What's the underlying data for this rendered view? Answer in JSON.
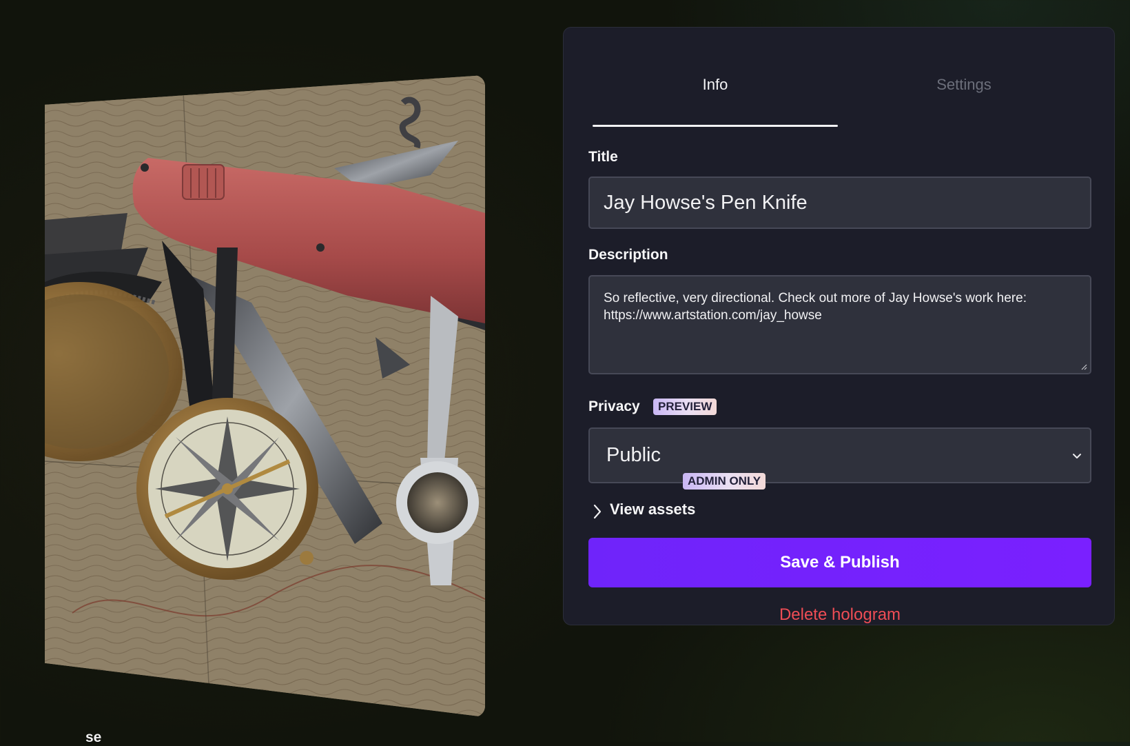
{
  "preview": {
    "caption": "se",
    "image_alt": "Red pen knife with compass on a topographic map"
  },
  "tabs": [
    {
      "label": "Info",
      "active": true
    },
    {
      "label": "Settings",
      "active": false
    }
  ],
  "form": {
    "title_label": "Title",
    "title_value": "Jay Howse's Pen Knife",
    "description_label": "Description",
    "description_value": "So reflective, very directional. Check out more of Jay Howse's work here: https://www.artstation.com/jay_howse",
    "privacy_label": "Privacy",
    "privacy_badge": "PREVIEW",
    "privacy_value": "Public",
    "assets_label": "View assets",
    "assets_badge": "ADMIN ONLY",
    "save_label": "Save & Publish",
    "delete_label": "Delete hologram"
  },
  "icons": {
    "select_arrow": "chevron-down-icon",
    "assets_expand": "chevron-right-icon",
    "textarea_resize": "resize-grip-icon"
  },
  "colors": {
    "panel_bg": "#1c1d29",
    "input_bg": "#2f313c",
    "accent_purple": "#7420fd",
    "danger_red": "#ef4d55",
    "badge_gradient_start": "#c9b7f4",
    "badge_gradient_end": "#f3d9d7"
  }
}
